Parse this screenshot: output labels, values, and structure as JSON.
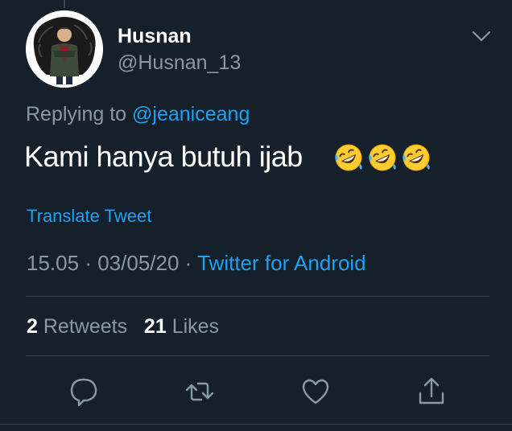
{
  "tweet": {
    "display_name": "Husnan",
    "handle": "@Husnan_13",
    "replying_prefix": "Replying to",
    "replying_to": "@jeaniceang",
    "text": "Kami hanya butuh ijab",
    "emojis": [
      "rolling-on-floor-laughing",
      "rolling-on-floor-laughing",
      "rolling-on-floor-laughing"
    ],
    "translate_label": "Translate Tweet",
    "time": "15.05",
    "separator": "·",
    "date": "03/05/20",
    "source": "Twitter for Android",
    "retweets_count": "2",
    "retweets_label": "Retweets",
    "likes_count": "21",
    "likes_label": "Likes"
  },
  "actions": [
    {
      "name": "reply",
      "icon": "speech-bubble-icon"
    },
    {
      "name": "retweet",
      "icon": "retweet-icon"
    },
    {
      "name": "like",
      "icon": "heart-icon"
    },
    {
      "name": "share",
      "icon": "share-icon"
    }
  ],
  "colors": {
    "background": "#15202b",
    "text_primary": "#ffffff",
    "text_secondary": "#8899a6",
    "accent": "#1da1f2",
    "divider": "#38444d"
  }
}
